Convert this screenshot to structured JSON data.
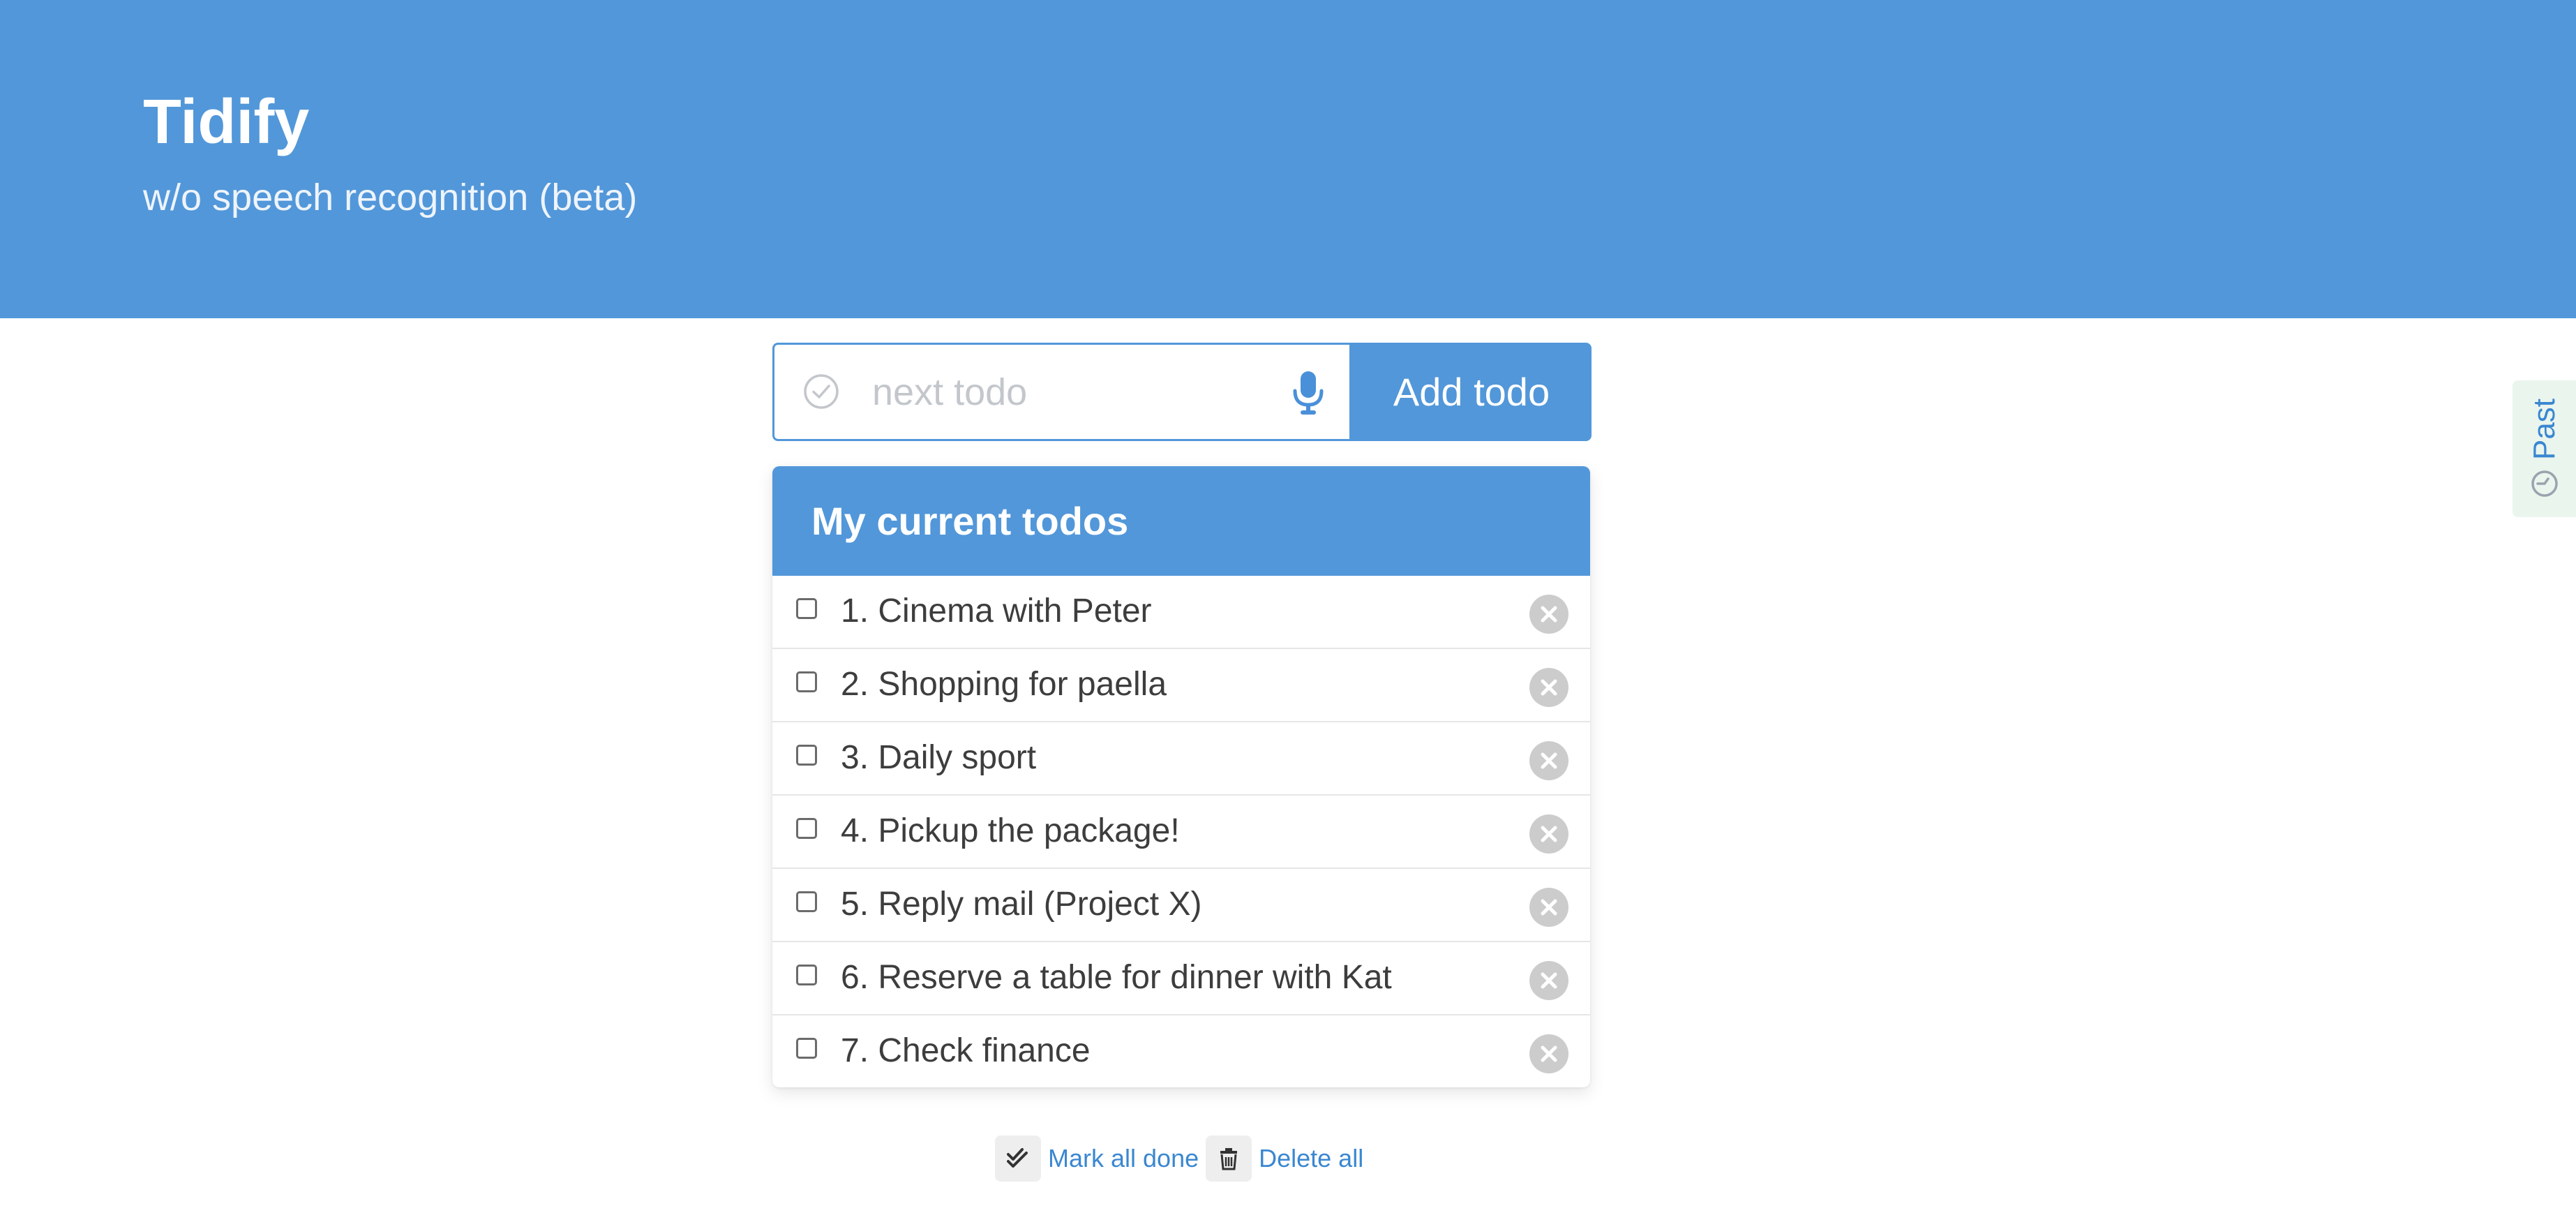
{
  "header": {
    "title": "Tidify",
    "subtitle": "w/o speech recognition (beta)"
  },
  "add_form": {
    "placeholder": "next todo",
    "value": "",
    "add_button_label": "Add todo"
  },
  "todo_panel": {
    "title": "My current todos",
    "items": [
      {
        "label": "1. Cinema with Peter",
        "done": false
      },
      {
        "label": "2. Shopping for paella",
        "done": false
      },
      {
        "label": "3. Daily sport",
        "done": false
      },
      {
        "label": "4. Pickup the package!",
        "done": false
      },
      {
        "label": "5. Reply mail (Project X)",
        "done": false
      },
      {
        "label": "6. Reserve a table for dinner with Kat",
        "done": false
      },
      {
        "label": "7. Check finance",
        "done": false
      }
    ]
  },
  "footer": {
    "mark_all_done_label": "Mark all done",
    "delete_all_label": "Delete all"
  },
  "side_tab": {
    "label": "Past"
  },
  "colors": {
    "primary": "#5297d9",
    "link": "#3b87d1",
    "muted": "#cccccc",
    "side_tab_bg": "#eaf5ee"
  },
  "icons": {
    "input_leading": "check-circle-icon",
    "input_trailing": "microphone-icon",
    "row_delete": "close-circle-icon",
    "mark_all_done": "double-check-icon",
    "delete_all": "trash-icon",
    "side_tab": "clock-icon"
  }
}
